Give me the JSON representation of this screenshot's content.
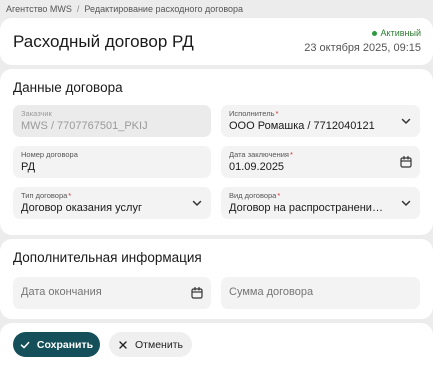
{
  "breadcrumb": {
    "root": "Агентство MWS",
    "separator": "/",
    "current": "Редактирование расходного договора"
  },
  "header": {
    "title": "Расходный договор РД",
    "status": "Активный",
    "timestamp": "23 октября 2025, 09:15"
  },
  "contract": {
    "section_title": "Данные договора",
    "customer": {
      "label": "Заказчик",
      "value": "MWS / 7707767501_PKIJ"
    },
    "executor": {
      "label": "Исполнитель",
      "required": "*",
      "value": "ООО Ромашка / 7712040121"
    },
    "number": {
      "label": "Номер договора",
      "value": "РД"
    },
    "date": {
      "label": "Дата заключения",
      "required": "*",
      "value": "01.09.2025"
    },
    "type": {
      "label": "Тип договора",
      "required": "*",
      "value": "Договор оказания услуг"
    },
    "kind": {
      "label": "Вид договора",
      "required": "*",
      "value": "Договор на распространение рек..."
    }
  },
  "extra": {
    "section_title": "Дополнительная информация",
    "end_date": {
      "placeholder": "Дата окончания"
    },
    "amount": {
      "placeholder": "Сумма договора"
    }
  },
  "actions": {
    "save_label": "Сохранить",
    "cancel_label": "Отменить"
  },
  "colors": {
    "primary": "#15505a",
    "status_green": "#2e7d32",
    "required_red": "#d32f2f"
  }
}
